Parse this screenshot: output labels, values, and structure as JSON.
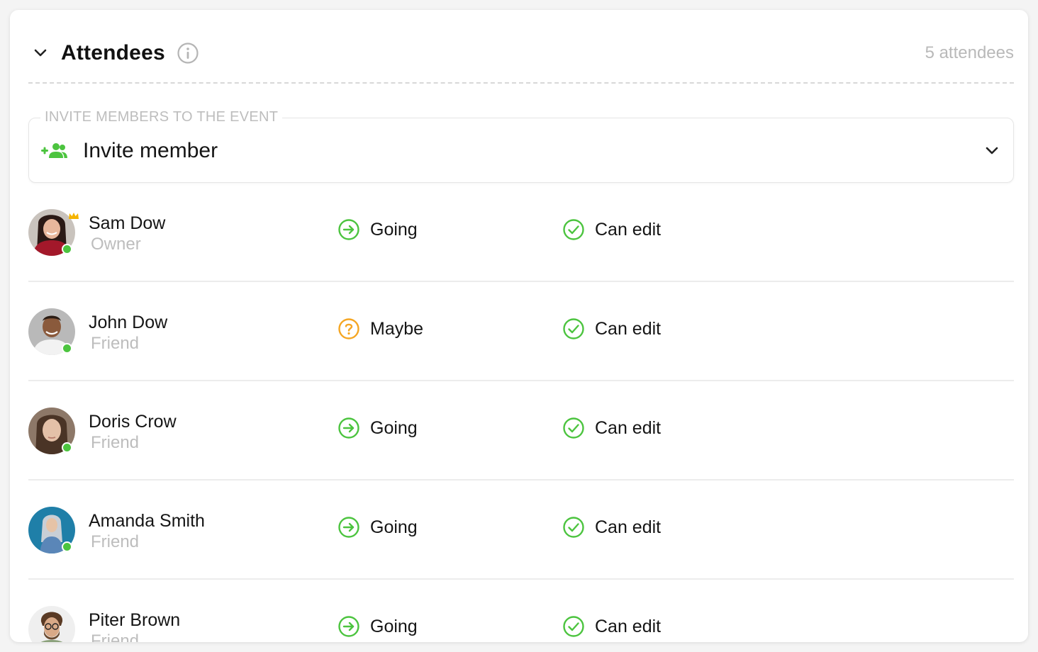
{
  "header": {
    "title": "Attendees",
    "count_label": "5 attendees"
  },
  "invite": {
    "legend": "INVITE MEMBERS TO THE EVENT",
    "label": "Invite member"
  },
  "colors": {
    "going": "#4cc43f",
    "maybe": "#f5a623",
    "can_edit": "#4cc43f",
    "online": "#4cc43f",
    "owner_crown": "#f5b400"
  },
  "attendees": [
    {
      "name": "Sam Dow",
      "role": "Owner",
      "status": "Going",
      "status_icon": "arrow-right-circle-icon",
      "permission": "Can edit",
      "permission_icon": "check-circle-icon",
      "owner": true
    },
    {
      "name": "John Dow",
      "role": "Friend",
      "status": "Maybe",
      "status_icon": "question-circle-icon",
      "permission": "Can edit",
      "permission_icon": "check-circle-icon",
      "owner": false
    },
    {
      "name": "Doris Crow",
      "role": "Friend",
      "status": "Going",
      "status_icon": "arrow-right-circle-icon",
      "permission": "Can edit",
      "permission_icon": "check-circle-icon",
      "owner": false
    },
    {
      "name": "Amanda Smith",
      "role": "Friend",
      "status": "Going",
      "status_icon": "arrow-right-circle-icon",
      "permission": "Can edit",
      "permission_icon": "check-circle-icon",
      "owner": false
    },
    {
      "name": "Piter Brown",
      "role": "Friend",
      "status": "Going",
      "status_icon": "arrow-right-circle-icon",
      "permission": "Can edit",
      "permission_icon": "check-circle-icon",
      "owner": false
    }
  ]
}
